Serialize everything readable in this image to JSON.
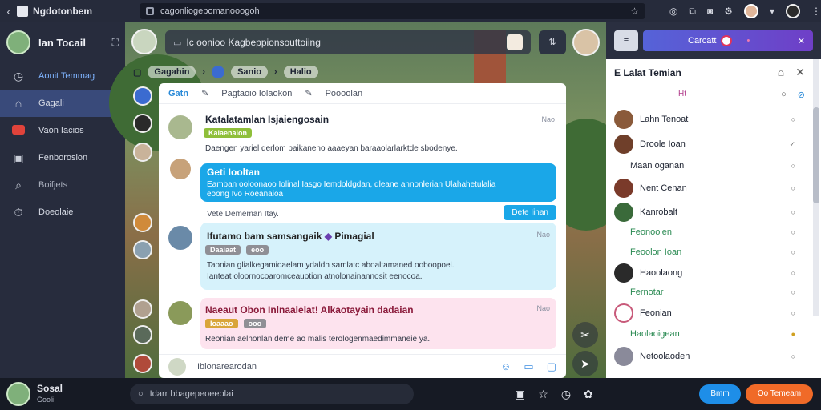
{
  "browser": {
    "app_title": "Ngdotonbem",
    "url": "cagonliogepomanooogoh"
  },
  "sidebar": {
    "user_name": "Ian Tocail",
    "items": [
      {
        "label": "Aonit Temmag",
        "icon": "clock-icon"
      },
      {
        "label": "Gagali",
        "icon": "home-icon"
      },
      {
        "label": "Vaon Iacios",
        "icon": "flag-icon"
      },
      {
        "label": "Fenborosion",
        "icon": "image-icon"
      },
      {
        "label": "Boifjets",
        "icon": "search-icon"
      },
      {
        "label": "Doeolaie",
        "icon": "alarm-icon"
      }
    ]
  },
  "topbar": {
    "search_text": "Ic oonioo Kagbeppionsouttoiing"
  },
  "channels": {
    "items": [
      "Gagahin",
      "Sanio",
      "Halio"
    ]
  },
  "chat": {
    "tabs": [
      "Gatn",
      "Pagtaoio Iolaokon",
      "Poooolan"
    ],
    "messages": [
      {
        "title": "Katalatamlan Isjaiengosain",
        "tags": [
          {
            "label": "Kaiaenaion",
            "color": "#8fbf3a"
          }
        ],
        "time": "Nao",
        "body": "Daengen yariel derlom baikaneno aaaeyan baraaolarlarktde sbodenye."
      },
      {
        "title": "Geti Iooltan",
        "body": "Eamban ooloonaoo Iolinal Iasgo Iemdoldgdan, dleane annonlerian Ulahahetulalia",
        "body2": "eoong Ivo Roeanaioa",
        "reply_note": "Vete Dememan Itay.",
        "reply_button": "Dete Iinan"
      },
      {
        "title": "Ifutamo bam samsangaik",
        "title2": "Pimagial",
        "tags": [
          {
            "label": "Daaiaat",
            "color": "#8f8f95"
          },
          {
            "label": "eoo",
            "color": "#8f8f95"
          }
        ],
        "time": "Nao",
        "body": "Taonian glialkegamioaelam ydaldh samlatc aboaltamaned ooboopoel.",
        "body2": "Ianteat oloornocoaromceauotion atnolonainannosit eenocoa."
      },
      {
        "title": "Naeaut Obon Inlnaalelat! Alkaotayain dadaian",
        "tags": [
          {
            "label": "Ioaaao",
            "color": "#d9a53a"
          },
          {
            "label": "ooo",
            "color": "#8f8f95"
          }
        ],
        "time": "Nao",
        "body": "Reonian aelnonlan deme ao malis terologenmaedimmaneie ya.."
      }
    ],
    "compose_placeholder": "Iblonarearodan"
  },
  "right_panel": {
    "header_label": "Carcatt",
    "title": "E Lalat Temian",
    "filter_label": "Ht",
    "contacts": [
      {
        "name": "Lahn Tenoat",
        "kind": "avatar",
        "color": "#8a5a3a"
      },
      {
        "name": "Droole Ioan",
        "kind": "avatar",
        "color": "#6f3f2a"
      },
      {
        "name": "Maan oganan",
        "kind": "sub"
      },
      {
        "name": "Nent Cenan",
        "kind": "avatar",
        "color": "#7a3a2a"
      },
      {
        "name": "Kanrobalt",
        "kind": "avatar",
        "color": "#3a6a3a"
      },
      {
        "name": "Feonoolen",
        "kind": "sub"
      },
      {
        "name": "Feoolon Ioan",
        "kind": "sub"
      },
      {
        "name": "Haoolaong",
        "kind": "avatar",
        "color": "#2a2a2a"
      },
      {
        "name": "Fernotar",
        "kind": "sub"
      },
      {
        "name": "Feonian",
        "kind": "avatar",
        "color": "#c85a7a"
      },
      {
        "name": "Haolaoigean",
        "kind": "sub"
      },
      {
        "name": "Netoolaoden",
        "kind": "avatar",
        "color": "#8a8a9a"
      }
    ]
  },
  "bottombar": {
    "user_name": "Sosal",
    "user_sub": "Gooli",
    "search_placeholder": "Idarr bbagepeoeeolai",
    "btn_primary": "Bmm",
    "btn_secondary": "Oo Temeam"
  }
}
